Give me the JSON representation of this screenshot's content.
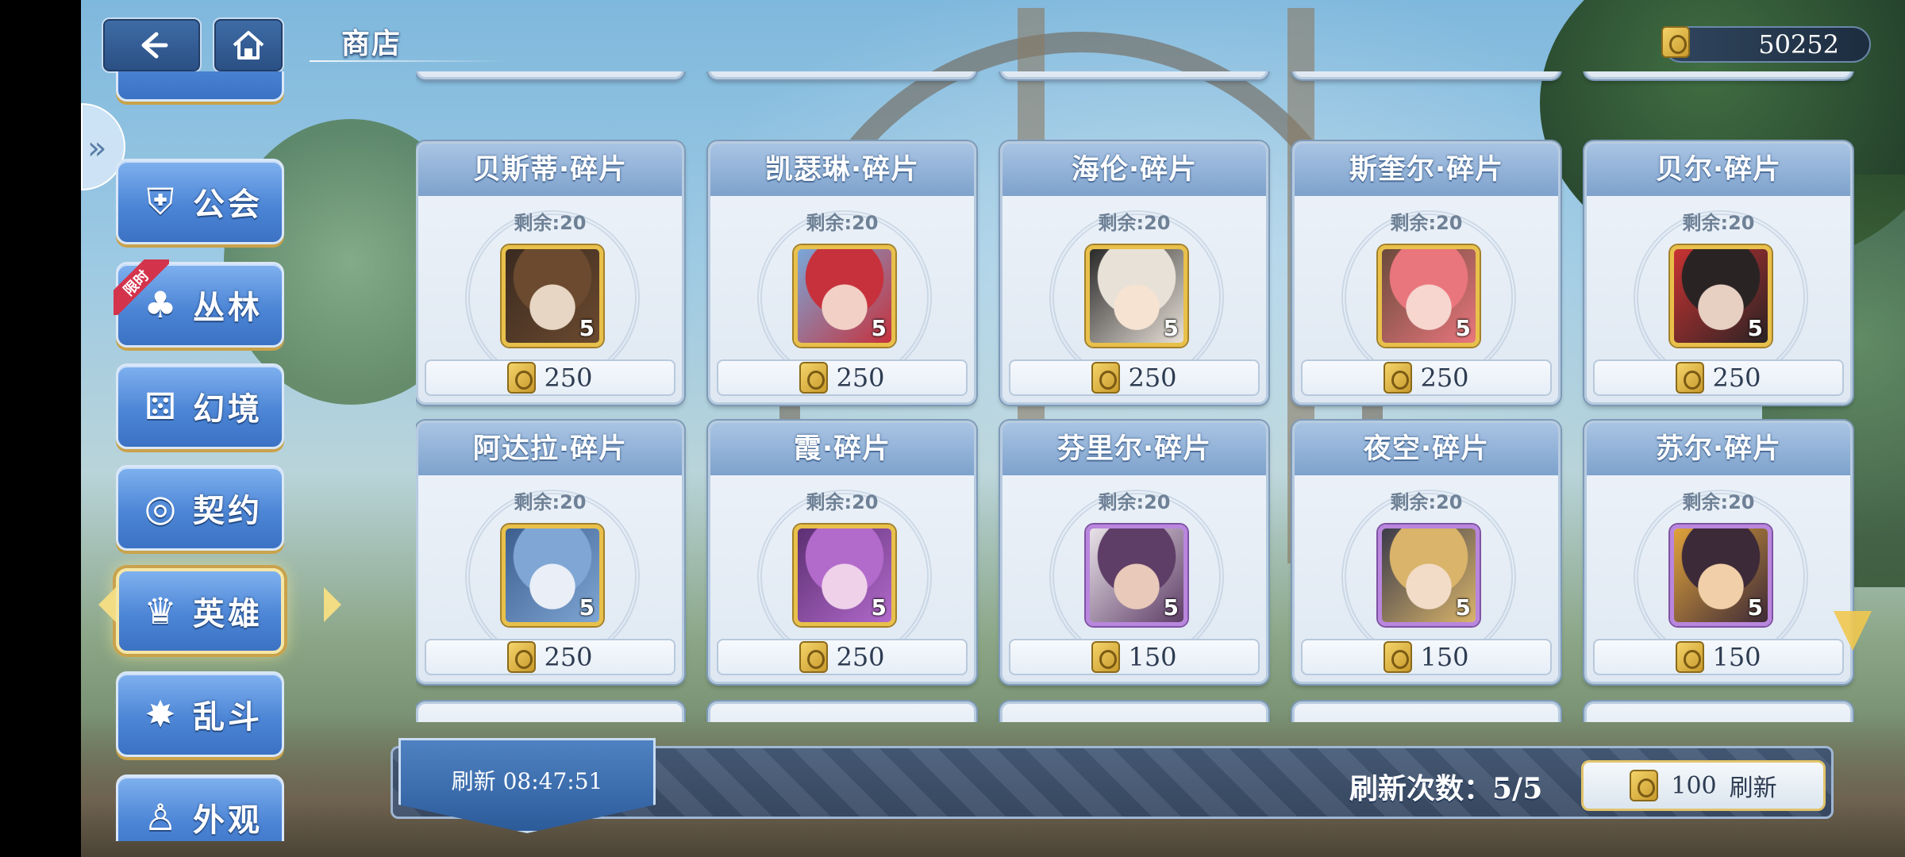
{
  "header": {
    "title": "商店",
    "currency_amount": "50252"
  },
  "sidebar": {
    "items": [
      {
        "label": "公会",
        "icon": "guild-icon"
      },
      {
        "label": "丛林",
        "icon": "forest-icon",
        "badge": "限时"
      },
      {
        "label": "幻境",
        "icon": "dice-icon"
      },
      {
        "label": "契约",
        "icon": "contract-icon"
      },
      {
        "label": "英雄",
        "icon": "hero-icon",
        "active": true
      },
      {
        "label": "乱斗",
        "icon": "brawl-icon"
      },
      {
        "label": "外观",
        "icon": "appearance-icon"
      }
    ]
  },
  "shop": {
    "items": [
      {
        "name": "贝斯蒂·碎片",
        "remain": "剩余:20",
        "qty": "5",
        "price": "250",
        "rarity": "gold"
      },
      {
        "name": "凯瑟琳·碎片",
        "remain": "剩余:20",
        "qty": "5",
        "price": "250",
        "rarity": "gold"
      },
      {
        "name": "海伦·碎片",
        "remain": "剩余:20",
        "qty": "5",
        "price": "250",
        "rarity": "gold"
      },
      {
        "name": "斯奎尔·碎片",
        "remain": "剩余:20",
        "qty": "5",
        "price": "250",
        "rarity": "gold"
      },
      {
        "name": "贝尔·碎片",
        "remain": "剩余:20",
        "qty": "5",
        "price": "250",
        "rarity": "gold"
      },
      {
        "name": "阿达拉·碎片",
        "remain": "剩余:20",
        "qty": "5",
        "price": "250",
        "rarity": "gold"
      },
      {
        "name": "霞·碎片",
        "remain": "剩余:20",
        "qty": "5",
        "price": "250",
        "rarity": "gold"
      },
      {
        "name": "芬里尔·碎片",
        "remain": "剩余:20",
        "qty": "5",
        "price": "150",
        "rarity": "purple"
      },
      {
        "name": "夜空·碎片",
        "remain": "剩余:20",
        "qty": "5",
        "price": "150",
        "rarity": "purple"
      },
      {
        "name": "苏尔·碎片",
        "remain": "剩余:20",
        "qty": "5",
        "price": "150",
        "rarity": "purple"
      }
    ]
  },
  "footer": {
    "refresh_timer": "刷新 08:47:51",
    "refresh_count": "刷新次数：5/5",
    "refresh_cost": "100",
    "refresh_label": "刷新"
  },
  "colors": {
    "gold_frame": "#e8c04a",
    "purple_frame": "#b986dd",
    "nav_blue": "#4d86d6"
  }
}
